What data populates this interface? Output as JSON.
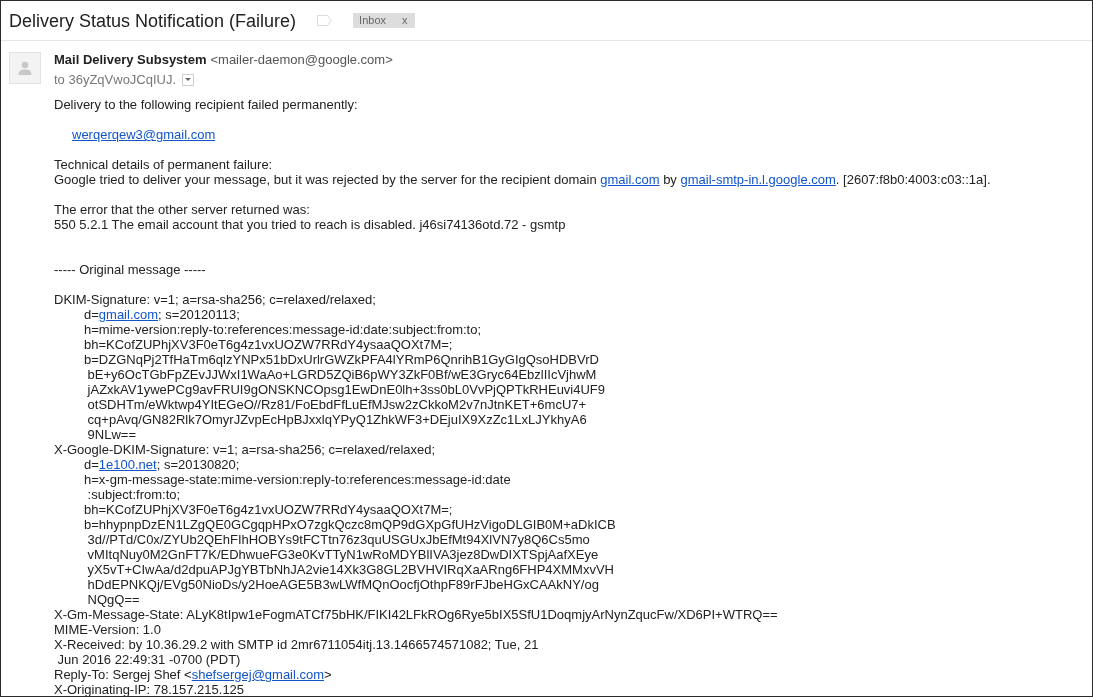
{
  "message": {
    "subject": "Delivery Status Notification (Failure)",
    "labels": [
      {
        "text": "Inbox",
        "remove": "x"
      }
    ]
  },
  "sender": {
    "name": "Mail Delivery Subsystem",
    "address": "<mailer-daemon@google.com>",
    "recipient": "to 36yZqVwoJCqIUJ."
  },
  "body": [
    {
      "kind": "text",
      "lines": [
        {
          "text": "Delivery to the following recipient failed permanently:"
        }
      ]
    },
    {
      "kind": "recipient",
      "lines": [
        {
          "parts": [
            {
              "kind": "link",
              "text": "werqerqew3@gmail.com"
            }
          ]
        }
      ]
    },
    {
      "kind": "text",
      "lines": [
        {
          "text": "Technical details of permanent failure:"
        },
        {
          "parts": [
            {
              "kind": "text",
              "text": "Google tried to deliver your message, but it was rejected by the server for the recipient domain "
            },
            {
              "kind": "link",
              "text": "gmail.com"
            },
            {
              "kind": "text",
              "text": " by "
            },
            {
              "kind": "link",
              "text": "gmail-smtp-in.l.google.com"
            },
            {
              "kind": "text",
              "text": ". [2607:f8b0:4003:c03::1a]."
            }
          ]
        }
      ]
    },
    {
      "kind": "text",
      "lines": [
        {
          "text": "The error that the other server returned was:"
        },
        {
          "text": "550 5.2.1 The email account that you tried to reach is disabled. j46si74136otd.72 - gsmtp"
        }
      ]
    },
    {
      "kind": "separator",
      "lines": [
        {
          "text": "----- Original message -----"
        }
      ]
    },
    {
      "kind": "headers",
      "lines": [
        {
          "text": "DKIM-Signature: v=1; a=rsa-sha256; c=relaxed/relaxed;",
          "children": [
            {
              "parts": [
                {
                  "kind": "text",
                  "text": "d="
                },
                {
                  "kind": "link",
                  "text": "gmail.com"
                },
                {
                  "kind": "text",
                  "text": "; s=20120113;"
                }
              ]
            },
            {
              "text": "h=mime-version:reply-to:references:message-id:date:subject:from:to;"
            },
            {
              "text": "bh=KCofZUPhjXV3F0eT6g4z1vxUOZW7RRdY4ysaaQOXt7M=;"
            },
            {
              "text": "b=DZGNqPj2TfHaTm6qlzYNPx51bDxUrlrGWZkPFA4lYRmP6QnrihB1GyGIgQsoHDBVrD"
            },
            {
              "text": " bE+y6OcTGbFpZEvJJWxI1WaAo+LGRD5ZQiB6pWY3ZkF0Bf/wE3Gryc64EbzlIIcVjhwM"
            },
            {
              "text": " jAZxkAV1ywePCg9avFRUI9gONSKNCOpsg1EwDnE0lh+3ss0bL0VvPjQPTkRHEuvi4UF9"
            },
            {
              "text": " otSDHTm/eWktwp4YItEGeO//Rz81/FoEbdFfLuEfMJsw2zCkkoM2v7nJtnKET+6mcU7+"
            },
            {
              "text": " cq+pAvq/GN82Rlk7OmyrJZvpEcHpBJxxlqYPyQ1ZhkWF3+DEjuIX9XzZc1LxLJYkhyA6"
            },
            {
              "text": " 9NLw=="
            }
          ]
        },
        {
          "text": "X-Google-DKIM-Signature: v=1; a=rsa-sha256; c=relaxed/relaxed;",
          "children": [
            {
              "parts": [
                {
                  "kind": "text",
                  "text": "d="
                },
                {
                  "kind": "link",
                  "text": "1e100.net"
                },
                {
                  "kind": "text",
                  "text": "; s=20130820;"
                }
              ]
            },
            {
              "text": "h=x-gm-message-state:mime-version:reply-to:references:message-id:date"
            },
            {
              "text": " :subject:from:to;"
            },
            {
              "text": "bh=KCofZUPhjXV3F0eT6g4z1vxUOZW7RRdY4ysaaQOXt7M=;"
            },
            {
              "text": "b=hhypnpDzEN1LZgQE0GCgqpHPxO7zgkQczc8mQP9dGXpGfUHzVigoDLGIB0M+aDkICB"
            },
            {
              "text": " 3d//PTd/C0x/ZYUb2QEhFIhHOBYs9tFCTtn76z3quUSGUxJbEfMt94XlVN7y8Q6Cs5mo"
            },
            {
              "text": " vMItqNuy0M2GnFT7K/EDhwueFG3e0KvTTyN1wRoMDYBlIVA3jez8DwDIXTSpjAafXEye"
            },
            {
              "text": " yX5vT+CIwAa/d2dpuAPJgYBTbNhJA2vie14Xk3G8GL2BVHVIRqXaARng6FHP4XMMxvVH"
            },
            {
              "text": " hDdEPNKQj/EVg50NioDs/y2HoeAGE5B3wLWfMQnOocfjOthpF89rFJbeHGxCAAkNY/og"
            },
            {
              "text": " NQgQ=="
            }
          ]
        },
        {
          "text": "X-Gm-Message-State: ALyK8tIpw1eFogmATCf75bHK/FIKI42LFkROg6Rye5bIX5SfU1DoqmjyArNynZqucFw/XD6PI+WTRQ=="
        },
        {
          "text": "MIME-Version: 1.0"
        },
        {
          "text": "X-Received: by 10.36.29.2 with SMTP id 2mr6711054itj.13.1466574571082; Tue, 21"
        },
        {
          "text": " Jun 2016 22:49:31 -0700 (PDT)"
        },
        {
          "parts": [
            {
              "kind": "text",
              "text": "Reply-To: Sergej Shef <"
            },
            {
              "kind": "link",
              "text": "shefsergej@gmail.com"
            },
            {
              "kind": "text",
              "text": ">"
            }
          ]
        },
        {
          "text": "X-Originating-IP: 78.157.215.125"
        }
      ]
    }
  ]
}
